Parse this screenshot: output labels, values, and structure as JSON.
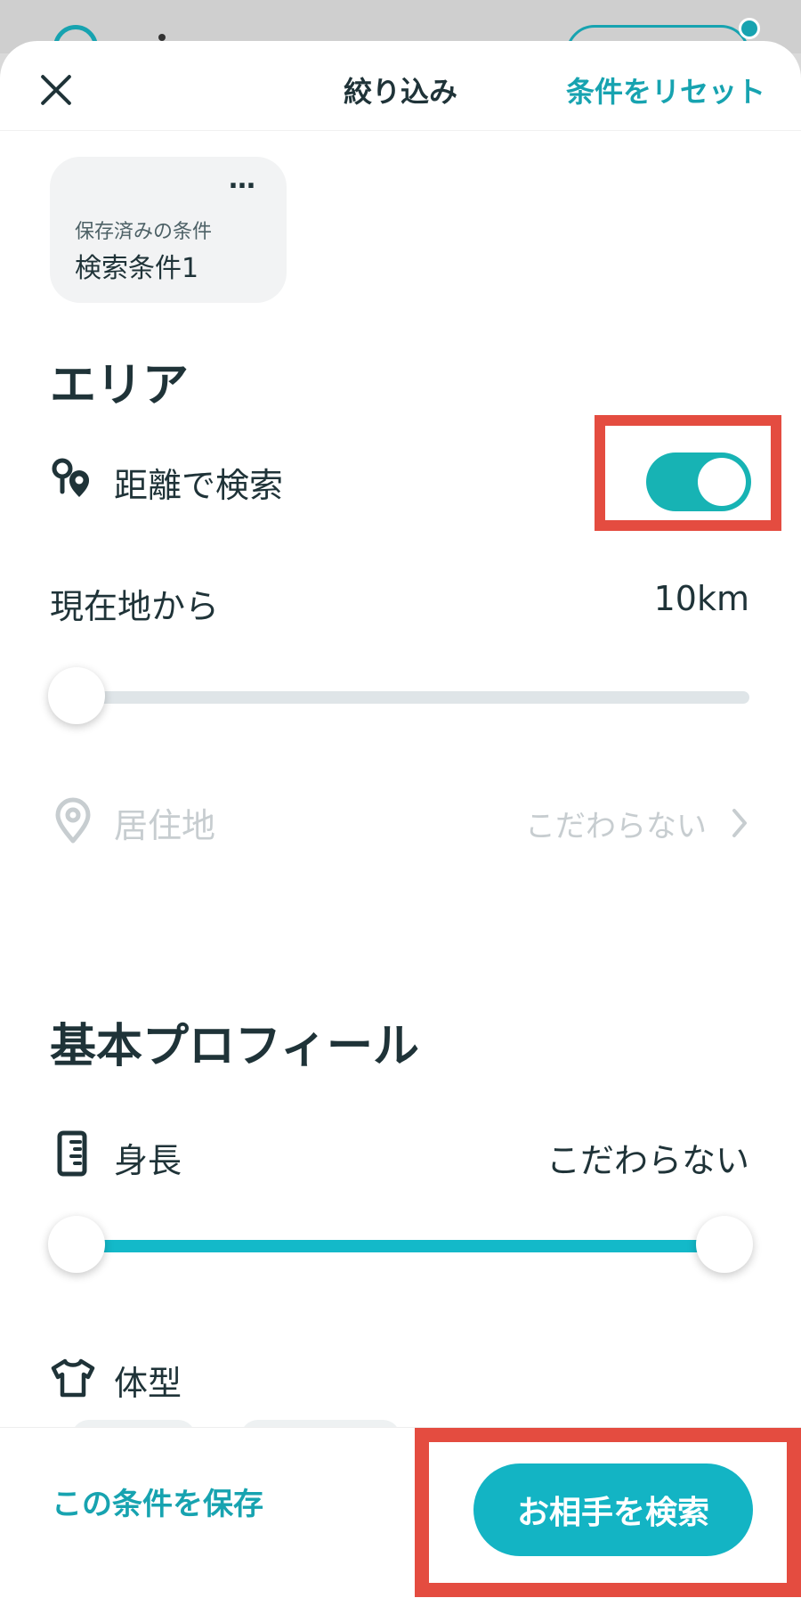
{
  "header": {
    "title": "絞り込み",
    "reset_label": "条件をリセット"
  },
  "saved_condition": {
    "label": "保存済みの条件",
    "name": "検索条件1",
    "more": "…"
  },
  "area": {
    "section_title": "エリア",
    "distance_search": {
      "label": "距離で検索",
      "enabled": true
    },
    "from_current": {
      "label": "現在地から",
      "value": "10km",
      "slider_fraction": 0.0
    },
    "residence": {
      "label": "居住地",
      "value": "こだわらない",
      "disabled": true
    }
  },
  "basic_profile": {
    "section_title": "基本プロフィール",
    "height": {
      "label": "身長",
      "value": "こだわらない",
      "range_fraction": [
        0.0,
        1.0
      ]
    },
    "body_type": {
      "label": "体型"
    }
  },
  "footer": {
    "save_label": "この条件を保存",
    "search_label": "お相手を検索"
  },
  "colors": {
    "accent": "#17a3b0",
    "highlight": "#e44c40",
    "toggle_on": "#17b3b4",
    "slider_fill": "#13b9c9"
  },
  "icons": [
    "close-icon",
    "more-icon",
    "distance-pin-icon",
    "location-pin-icon",
    "chevron-right-icon",
    "ruler-icon",
    "shirt-icon"
  ]
}
